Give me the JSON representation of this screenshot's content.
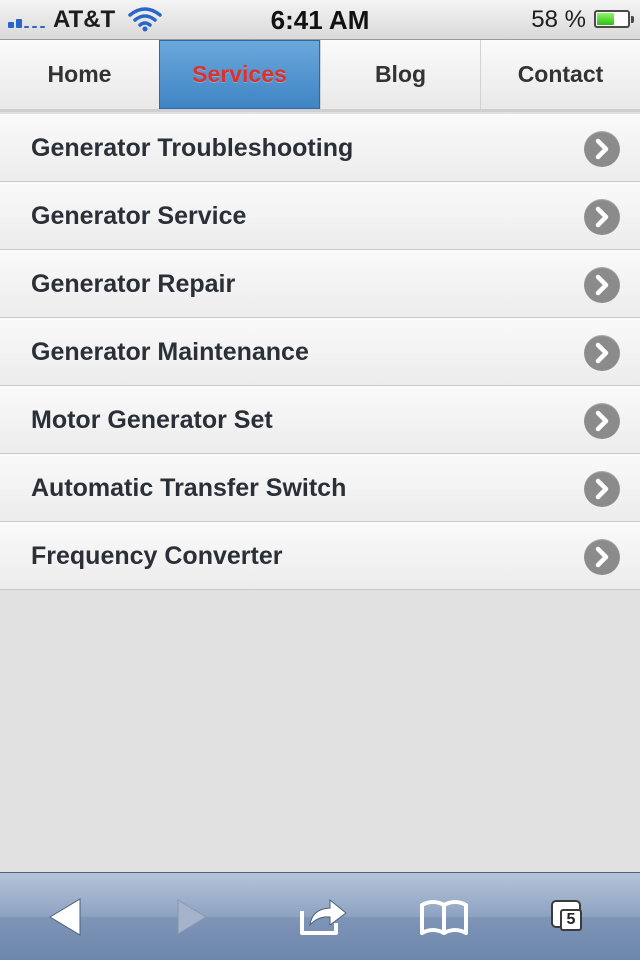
{
  "status_bar": {
    "carrier": "AT&T",
    "time": "6:41 AM",
    "battery_percent": "58 %",
    "battery_level": 0.58,
    "signal_icon": "signal-bars-icon",
    "wifi_icon": "wifi-icon",
    "battery_icon": "battery-icon"
  },
  "nav": {
    "tabs": [
      {
        "label": "Home",
        "active": false
      },
      {
        "label": "Services",
        "active": true
      },
      {
        "label": "Blog",
        "active": false
      },
      {
        "label": "Contact",
        "active": false
      }
    ]
  },
  "services": {
    "items": [
      {
        "label": "Generator Troubleshooting"
      },
      {
        "label": "Generator Service"
      },
      {
        "label": "Generator Repair"
      },
      {
        "label": "Generator Maintenance"
      },
      {
        "label": "Motor Generator Set"
      },
      {
        "label": "Automatic Transfer Switch"
      },
      {
        "label": "Frequency Converter"
      }
    ],
    "item_icon": "chevron-right-circle-icon"
  },
  "toolbar": {
    "back_icon": "back-arrow-icon",
    "forward_icon": "forward-arrow-icon",
    "share_icon": "share-icon",
    "bookmarks_icon": "bookmarks-book-icon",
    "tabs_icon": "tabs-icon",
    "tabs_count": "5"
  },
  "colors": {
    "active_tab_bg": "#4f92cf",
    "active_tab_text": "#e0302a",
    "list_text": "#2b3038",
    "chevron_bg": "#8b8b8b",
    "toolbar_bg": "#8ea3c1"
  }
}
